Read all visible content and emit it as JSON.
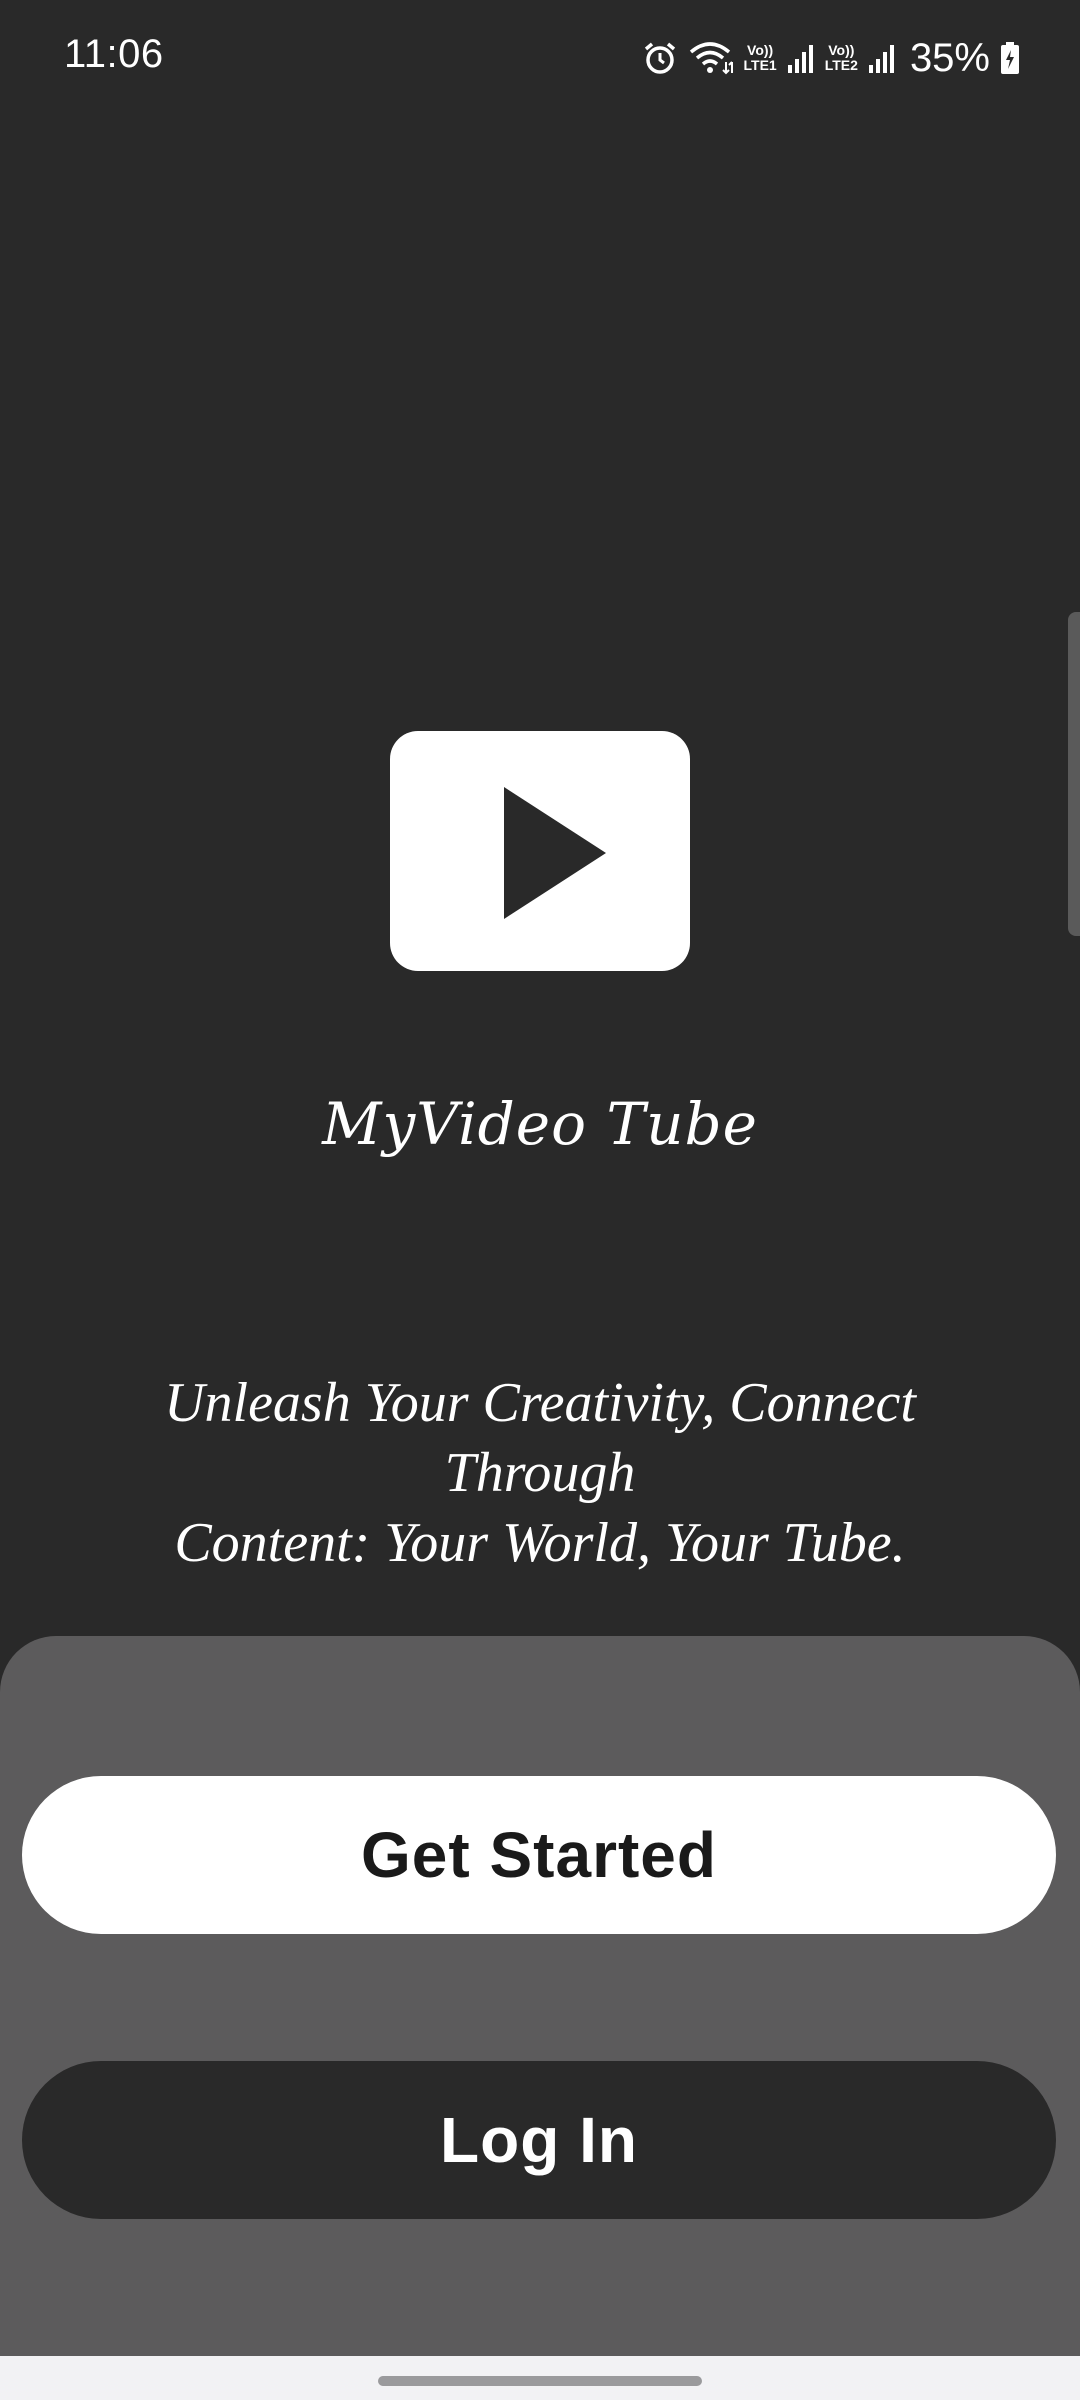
{
  "status_bar": {
    "time": "11:06",
    "icons": [
      "alarm-icon",
      "wifi-icon",
      "volte-lte1-icon",
      "signal-icon",
      "volte-lte2-icon",
      "signal-icon",
      "battery-charging-icon"
    ],
    "sim1_top": "Vo))",
    "sim1_bottom": "LTE1",
    "sim2_top": "Vo))",
    "sim2_bottom": "LTE2",
    "battery_percent": "35%"
  },
  "logo": {
    "icon": "play-icon",
    "background_color": "#ffffff",
    "icon_color": "#292929"
  },
  "app_name": "MyVideo Tube",
  "tagline_line1": "Unleash Your Creativity, Connect Through",
  "tagline_line2": "Content: Your World, Your Tube.",
  "actions": {
    "get_started_label": "Get Started",
    "log_in_label": "Log In"
  },
  "colors": {
    "background": "#292929",
    "sheet": "#5c5b5c",
    "primary_button": "#ffffff",
    "secondary_button": "#292929"
  }
}
